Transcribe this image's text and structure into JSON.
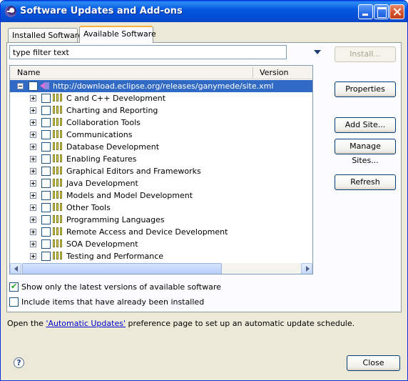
{
  "window": {
    "title": "Software Updates and Add-ons",
    "controls": {
      "minimize": "minimize-icon",
      "maximize": "maximize-icon",
      "close": "close-icon"
    }
  },
  "tabs": [
    {
      "label": "Installed Software",
      "active": false
    },
    {
      "label": "Available Software",
      "active": true
    }
  ],
  "filter": {
    "value": "type filter text"
  },
  "buttons": {
    "install": "Install...",
    "properties": "Properties",
    "add_site": "Add Site...",
    "manage_sites": "Manage Sites...",
    "refresh": "Refresh",
    "close": "Close"
  },
  "tree": {
    "columns": [
      "Name",
      "Version"
    ],
    "site": {
      "label": "http://download.eclipse.org/releases/ganymede/site.xml",
      "expanded": true,
      "selected": true
    },
    "categories": [
      "C and C++ Development",
      "Charting and Reporting",
      "Collaboration Tools",
      "Communications",
      "Database Development",
      "Enabling Features",
      "Graphical Editors and Frameworks",
      "Java Development",
      "Models and Model Development",
      "Other Tools",
      "Programming Languages",
      "Remote Access and Device Development",
      "SOA Development",
      "Testing and Performance"
    ]
  },
  "options": {
    "latest_only": {
      "label": "Show only the latest versions of available software",
      "checked": true
    },
    "include_installed": {
      "label": "Include items that have already been installed",
      "checked": false
    }
  },
  "note": {
    "prefix": "Open the ",
    "link": "'Automatic Updates'",
    "suffix": " preference page to set up an automatic update schedule."
  },
  "help": {
    "icon": "help-icon",
    "glyph": "?"
  },
  "colors": {
    "titlebar": "#0559e0",
    "selection": "#316ac5",
    "link": "#0000cc",
    "dialog_bg": "#ece9d8"
  }
}
